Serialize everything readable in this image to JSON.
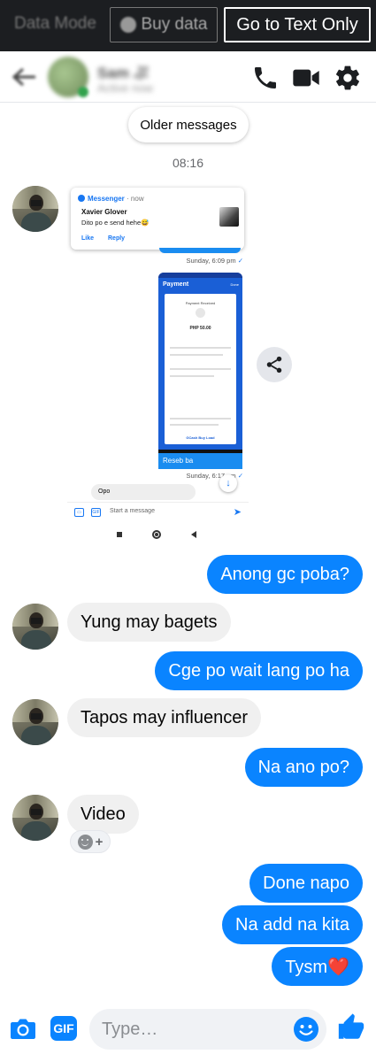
{
  "topbar": {
    "data_mode_label": "Data Mode",
    "buy_data_label": "Buy data",
    "text_only_label": "Go to Text Only"
  },
  "header": {
    "contact_name": "Sam ぷ",
    "status": "Active now"
  },
  "thread": {
    "older_messages_label": "Older messages",
    "timestamp": "08:16"
  },
  "shared_screenshot": {
    "notification": {
      "app_name": "Messenger",
      "time_ago": "· now",
      "sender": "Xavier Glover",
      "message": "Dito po e send hehe😅",
      "action_like": "Like",
      "action_reply": "Reply"
    },
    "timestamp_1": "Sunday, 6:09 pm",
    "payment": {
      "title": "Payment",
      "done": "Done",
      "received": "Payment Received",
      "amount": "PHP 50.00",
      "brand": "GCash Buy Load"
    },
    "caption": "Reseb ba",
    "timestamp_2": "Sunday, 6:17 pm",
    "reply_text": "Opo",
    "composer_placeholder": "Start a message",
    "composer_gif": "GIF"
  },
  "messages": [
    {
      "direction": "out",
      "text": "Anong gc poba?"
    },
    {
      "direction": "in",
      "text": "Yung may bagets"
    },
    {
      "direction": "out",
      "text": "Cge po wait lang po ha"
    },
    {
      "direction": "in",
      "text": "Tapos may influencer"
    },
    {
      "direction": "out",
      "text": "Na ano po?"
    },
    {
      "direction": "in",
      "text": "Video"
    },
    {
      "direction": "out",
      "text": "Done napo"
    },
    {
      "direction": "out",
      "text": "Na add na kita"
    },
    {
      "direction": "out",
      "text": "Tysm❤️"
    }
  ],
  "composer": {
    "gif_label": "GIF",
    "placeholder": "Type…"
  },
  "colors": {
    "accent": "#0a84ff",
    "incoming_bubble": "#f0f0f0",
    "topbar": "#1c1e21"
  },
  "icons": {
    "header": [
      "back-arrow-icon",
      "phone-icon",
      "video-camera-icon",
      "gear-icon"
    ],
    "composer": [
      "camera-icon",
      "gif-icon",
      "emoji-icon",
      "thumbs-up-icon"
    ]
  }
}
